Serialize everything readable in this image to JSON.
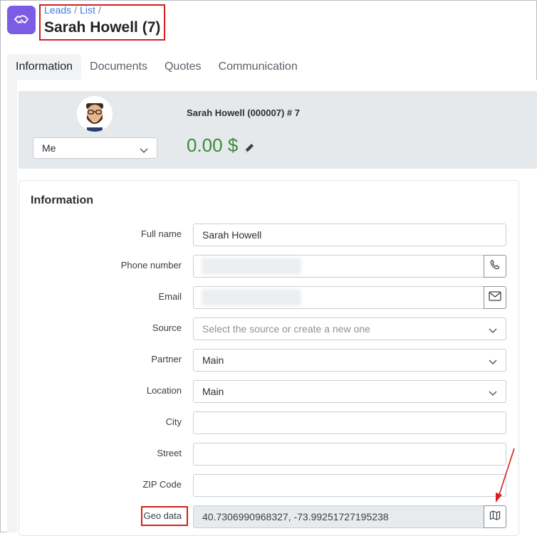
{
  "breadcrumb": [
    "Leads",
    "List"
  ],
  "page_title": "Sarah Howell (7)",
  "tabs": [
    "Information",
    "Documents",
    "Quotes",
    "Communication"
  ],
  "manager_select": "Me",
  "lead_header": {
    "name": "Sarah Howell (000007) # 7",
    "balance": "0.00 $"
  },
  "info_section_title": "Information",
  "form": {
    "full_name": {
      "label": "Full name",
      "value": "Sarah Howell"
    },
    "phone": {
      "label": "Phone number",
      "value": ""
    },
    "email": {
      "label": "Email",
      "value": ""
    },
    "source": {
      "label": "Source",
      "placeholder": "Select the source or create a new one"
    },
    "partner": {
      "label": "Partner",
      "value": "Main"
    },
    "location": {
      "label": "Location",
      "value": "Main"
    },
    "city": {
      "label": "City",
      "value": ""
    },
    "street": {
      "label": "Street",
      "value": ""
    },
    "zip": {
      "label": "ZIP Code",
      "value": ""
    },
    "geo": {
      "label": "Geo data",
      "value": "40.7306990968327, -73.99251727195238"
    }
  },
  "colors": {
    "accent": "#7c5ce5",
    "link": "#3b7de0",
    "balance": "#3c8a3c",
    "highlight": "#d42020"
  },
  "icons": {
    "app": "handshake-icon",
    "phone": "phone-icon",
    "email": "envelope-icon",
    "geo": "map-icon",
    "edit": "pencil-icon"
  }
}
